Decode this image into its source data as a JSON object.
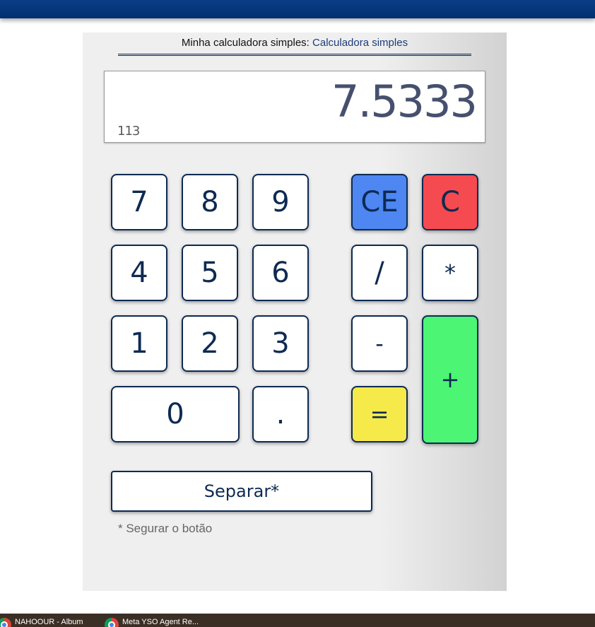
{
  "header": {
    "title_prefix": "Minha calculadora simples:",
    "title_link": "Calculadora simples"
  },
  "display": {
    "value": "7.5333",
    "history": "113"
  },
  "keys": {
    "k7": "7",
    "k8": "8",
    "k9": "9",
    "k4": "4",
    "k5": "5",
    "k6": "6",
    "k1": "1",
    "k2": "2",
    "k3": "3",
    "k0": "0",
    "dot": ".",
    "ce": "CE",
    "c": "C",
    "divide": "/",
    "multiply": "*",
    "minus": "-",
    "plus": "+",
    "equals": "="
  },
  "separar": {
    "label": "Separar*",
    "hint": "* Segurar o botão"
  },
  "taskbar": {
    "items": [
      "NAHOOUR - Album",
      "Meta YSO Agent Re..."
    ]
  },
  "colors": {
    "topbar": "#003a80",
    "ce": "#4e86f2",
    "c": "#f54a50",
    "equals": "#f6ea4b",
    "plus": "#4cf573",
    "key_border": "#0d2a52"
  },
  "icons": {
    "taskbar_app": "chrome-icon"
  }
}
